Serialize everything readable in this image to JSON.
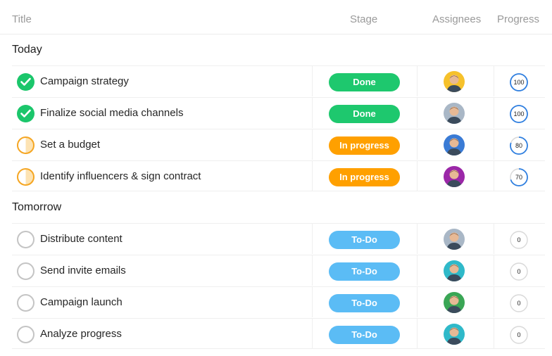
{
  "header": {
    "title": "Title",
    "stage": "Stage",
    "assignees": "Assignees",
    "progress": "Progress"
  },
  "groups": [
    {
      "label": "Today",
      "tasks": [
        {
          "title": "Campaign strategy",
          "status": "done",
          "stage": "Done",
          "progress": "100",
          "progress_value": 100,
          "avatar_color": "#f6c12b"
        },
        {
          "title": "Finalize social media channels",
          "status": "done",
          "stage": "Done",
          "progress": "100",
          "progress_value": 100,
          "avatar_color": "#a9b7c6"
        },
        {
          "title": "Set a budget",
          "status": "in-progress",
          "stage": "In progress",
          "progress": "80",
          "progress_value": 80,
          "avatar_color": "#3a7bd5"
        },
        {
          "title": "Identify influencers & sign contract",
          "status": "in-progress",
          "stage": "In progress",
          "progress": "70",
          "progress_value": 70,
          "avatar_color": "#9b27a8"
        }
      ]
    },
    {
      "label": "Tomorrow",
      "tasks": [
        {
          "title": "Distribute content",
          "status": "todo",
          "stage": "To-Do",
          "progress": "0",
          "progress_value": 0,
          "avatar_color": "#a9b7c6"
        },
        {
          "title": "Send invite emails",
          "status": "todo",
          "stage": "To-Do",
          "progress": "0",
          "progress_value": 0,
          "avatar_color": "#2fb9c9"
        },
        {
          "title": "Campaign launch",
          "status": "todo",
          "stage": "To-Do",
          "progress": "0",
          "progress_value": 0,
          "avatar_color": "#3aa655"
        },
        {
          "title": "Analyze progress",
          "status": "todo",
          "stage": "To-Do",
          "progress": "0",
          "progress_value": 0,
          "avatar_color": "#2fb9c9"
        }
      ]
    }
  ],
  "colors": {
    "done": "#1ec86e",
    "in_progress": "#ffa000",
    "todo": "#5bbcf5",
    "progress_ring": "#2f7fe0"
  }
}
